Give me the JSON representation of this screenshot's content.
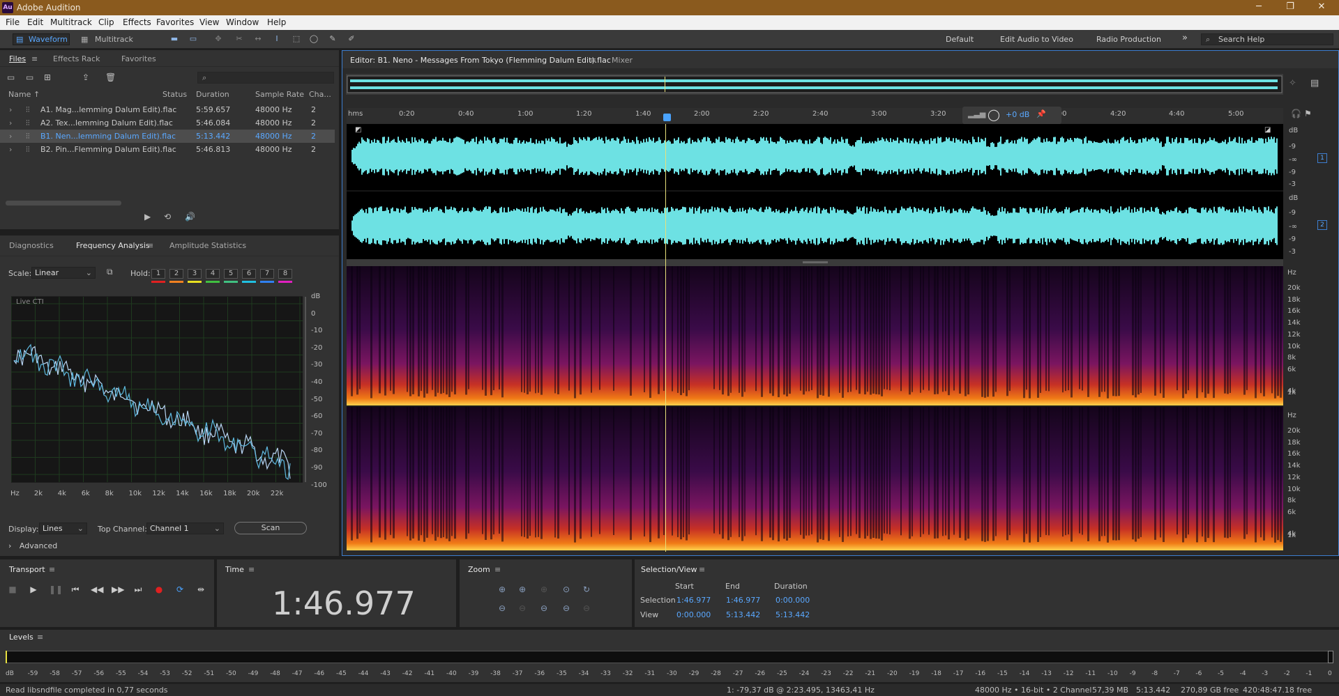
{
  "app": {
    "title": "Adobe Audition",
    "logo": "Au"
  },
  "window_controls": {
    "minimize": "─",
    "restore": "❐",
    "close": "✕"
  },
  "menu": [
    "File",
    "Edit",
    "Multitrack",
    "Clip",
    "Effects",
    "Favorites",
    "View",
    "Window",
    "Help"
  ],
  "toolbar": {
    "waveform_label": "Waveform",
    "multitrack_label": "Multitrack",
    "workspaces": [
      "Default",
      "Edit Audio to Video",
      "Radio Production"
    ],
    "more": "»",
    "search_placeholder": "Search Help"
  },
  "files_panel": {
    "tabs": [
      "Files",
      "Effects Rack",
      "Favorites"
    ],
    "search_glyph": "⌕",
    "columns": [
      "Name ↑",
      "Status",
      "Duration",
      "Sample Rate",
      "Cha..."
    ],
    "rows": [
      {
        "name": "A1. Mag...lemming Dalum Edit).flac",
        "duration": "5:59.657",
        "rate": "48000 Hz",
        "ch": "2",
        "selected": false
      },
      {
        "name": "A2. Tex...lemming Dalum Edit).flac",
        "duration": "5:46.084",
        "rate": "48000 Hz",
        "ch": "2",
        "selected": false
      },
      {
        "name": "B1. Nen...lemming Dalum Edit).flac",
        "duration": "5:13.442",
        "rate": "48000 Hz",
        "ch": "2",
        "selected": true
      },
      {
        "name": "B2. Pin...Flemming Dalum Edit).flac",
        "duration": "5:46.813",
        "rate": "48000 Hz",
        "ch": "2",
        "selected": false
      }
    ]
  },
  "analysis_panel": {
    "tabs": [
      "Diagnostics",
      "Frequency Analysis",
      "Amplitude Statistics"
    ],
    "scale_label": "Scale:",
    "scale_value": "Linear",
    "hold_label": "Hold:",
    "holds": [
      "1",
      "2",
      "3",
      "4",
      "5",
      "6",
      "7",
      "8"
    ],
    "hold_colors": [
      "#e02020",
      "#f08020",
      "#e8e020",
      "#40c040",
      "#40c080",
      "#20c0e0",
      "#3080f0",
      "#e020c0"
    ],
    "graph_label": "Live CTI",
    "db_axis": [
      "dB",
      "0",
      "-10",
      "-20",
      "-30",
      "-40",
      "-50",
      "-60",
      "-70",
      "-80",
      "-90",
      "-100"
    ],
    "hz_axis": [
      "Hz",
      "2k",
      "4k",
      "6k",
      "8k",
      "10k",
      "12k",
      "14k",
      "16k",
      "18k",
      "20k",
      "22k"
    ],
    "display_label": "Display:",
    "display_value": "Lines",
    "top_channel_label": "Top Channel:",
    "top_channel_value": "Channel 1",
    "scan_label": "Scan",
    "advanced_label": "Advanced"
  },
  "editor": {
    "tab": "Editor: B1. Neno - Messages From Tokyo (Flemming Dalum Edit).flac",
    "mixer_tab": "Mixer",
    "time_ruler": [
      "hms",
      "0:20",
      "0:40",
      "1:00",
      "1:20",
      "1:40",
      "2:00",
      "2:20",
      "2:40",
      "3:00",
      "3:20",
      "4:00",
      "4:20",
      "4:40",
      "5:00"
    ],
    "hud_gain": "+0 dB",
    "channel_db": [
      "dB",
      "-9",
      "-∞",
      "-9",
      "-3"
    ],
    "channel_badges": [
      "1",
      "2"
    ],
    "spectral_hz": [
      "Hz",
      "20k",
      "18k",
      "16k",
      "14k",
      "12k",
      "10k",
      "8k",
      "6k",
      "4k",
      "1k"
    ]
  },
  "transport": {
    "title": "Transport"
  },
  "time": {
    "title": "Time",
    "value": "1:46.977"
  },
  "zoom": {
    "title": "Zoom"
  },
  "selection_view": {
    "title": "Selection/View",
    "cols": [
      "Start",
      "End",
      "Duration"
    ],
    "selection_label": "Selection",
    "view_label": "View",
    "selection": [
      "1:46.977",
      "1:46.977",
      "0:00.000"
    ],
    "view": [
      "0:00.000",
      "5:13.442",
      "5:13.442"
    ]
  },
  "levels": {
    "title": "Levels",
    "scale": [
      "dB",
      "-59",
      "-58",
      "-57",
      "-56",
      "-55",
      "-54",
      "-53",
      "-52",
      "-51",
      "-50",
      "-49",
      "-48",
      "-47",
      "-46",
      "-45",
      "-44",
      "-43",
      "-42",
      "-41",
      "-40",
      "-39",
      "-38",
      "-37",
      "-36",
      "-35",
      "-34",
      "-33",
      "-32",
      "-31",
      "-30",
      "-29",
      "-28",
      "-27",
      "-26",
      "-25",
      "-24",
      "-23",
      "-22",
      "-21",
      "-20",
      "-19",
      "-18",
      "-17",
      "-16",
      "-15",
      "-14",
      "-13",
      "-12",
      "-11",
      "-10",
      "-9",
      "-8",
      "-7",
      "-6",
      "-5",
      "-4",
      "-3",
      "-2",
      "-1",
      "0"
    ]
  },
  "status": {
    "left": "Read libsndfile completed in 0,77 seconds",
    "cursor": "1: -79,37 dB @ 2:23.495, 13463,41 Hz",
    "format": "48000 Hz • 16-bit • 2 Channel",
    "size": "57,39 MB",
    "duration": "5:13.442",
    "free": "270,89 GB free",
    "free_time": "420:48:47.18 free"
  },
  "colors": {
    "accent": "#5aa8ff",
    "waveform": "#6de1e3",
    "playhead": "#e8e07a"
  }
}
